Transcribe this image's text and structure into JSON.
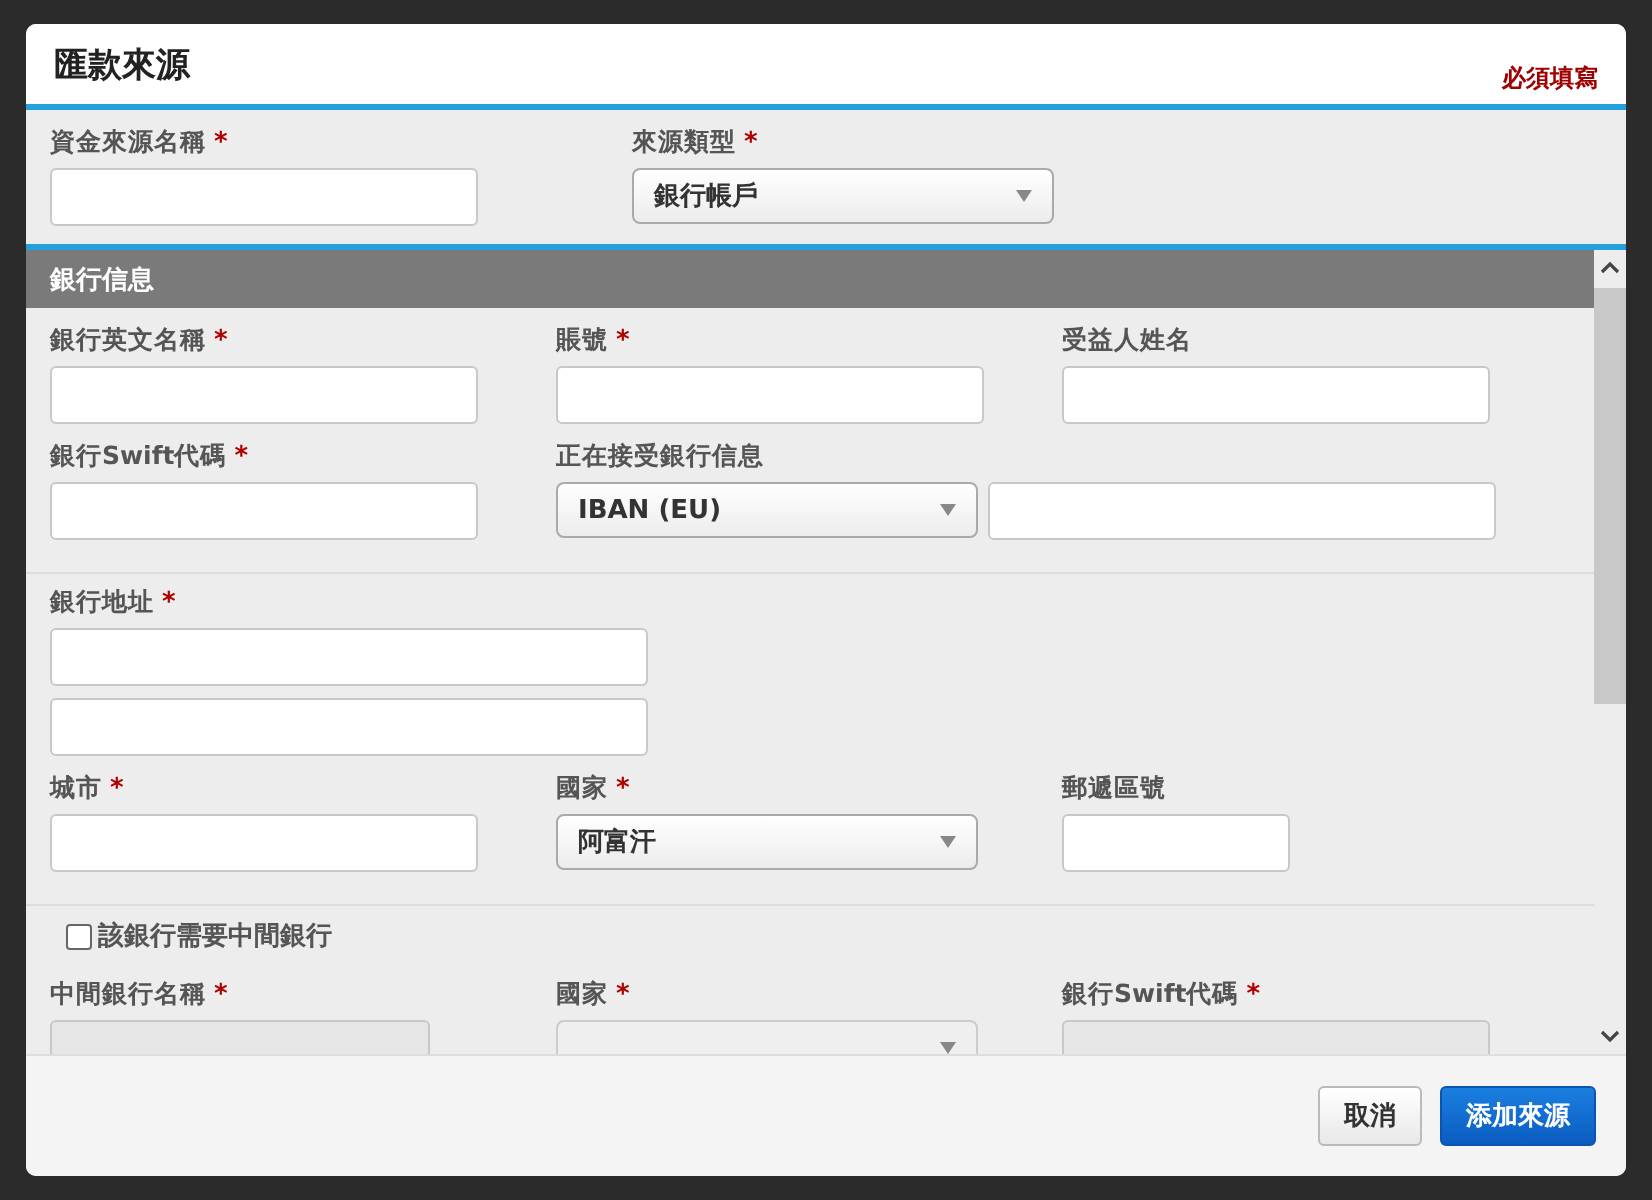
{
  "dialog": {
    "title": "匯款來源",
    "required_note": "必須填寫"
  },
  "source": {
    "fields": [
      {
        "label": "資金來源名稱",
        "required_mark": "*",
        "kind": "text",
        "disabled": false
      },
      {
        "label": "來源類型",
        "required_mark": "*",
        "kind": "select",
        "value": "銀行帳戶",
        "disabled": false
      }
    ]
  },
  "bank_section": {
    "heading": "銀行信息",
    "groups": [
      {
        "rows": [
          [
            {
              "label": "銀行英文名稱",
              "required_mark": "*",
              "kind": "text",
              "disabled": false
            },
            {
              "label": "賬號",
              "required_mark": "*",
              "kind": "text",
              "disabled": false
            },
            {
              "label": "受益人姓名",
              "kind": "text",
              "disabled": false
            }
          ],
          [
            {
              "label": "銀行Swift代碼",
              "required_mark": "*",
              "kind": "text",
              "disabled": false
            },
            {
              "label": "正在接受銀行信息",
              "kind": "select_with_input",
              "value": "IBAN (EU)",
              "disabled": false
            }
          ]
        ]
      },
      {
        "rows": [
          [
            {
              "label": "銀行地址",
              "required_mark": "*",
              "kind": "address",
              "disabled": false
            }
          ],
          [
            {
              "label": "城市",
              "required_mark": "*",
              "kind": "text",
              "disabled": false
            },
            {
              "label": "國家",
              "required_mark": "*",
              "kind": "select",
              "value": "阿富汗",
              "disabled": false
            },
            {
              "label": "郵遞區號",
              "kind": "postcode",
              "disabled": false
            }
          ]
        ]
      },
      {
        "checkbox": {
          "label": "該銀行需要中間銀行",
          "checked": false
        },
        "rows": [
          [
            {
              "label": "中間銀行名稱",
              "required_mark": "*",
              "kind": "short_text",
              "disabled": true
            },
            {
              "label": "國家",
              "required_mark": "*",
              "kind": "select",
              "disabled": true
            },
            {
              "label": "銀行Swift代碼",
              "required_mark": "*",
              "kind": "text",
              "disabled": true
            }
          ]
        ]
      }
    ]
  },
  "buttons": [
    {
      "label": "取消",
      "kind": "secondary"
    },
    {
      "label": "添加來源",
      "kind": "primary"
    }
  ]
}
